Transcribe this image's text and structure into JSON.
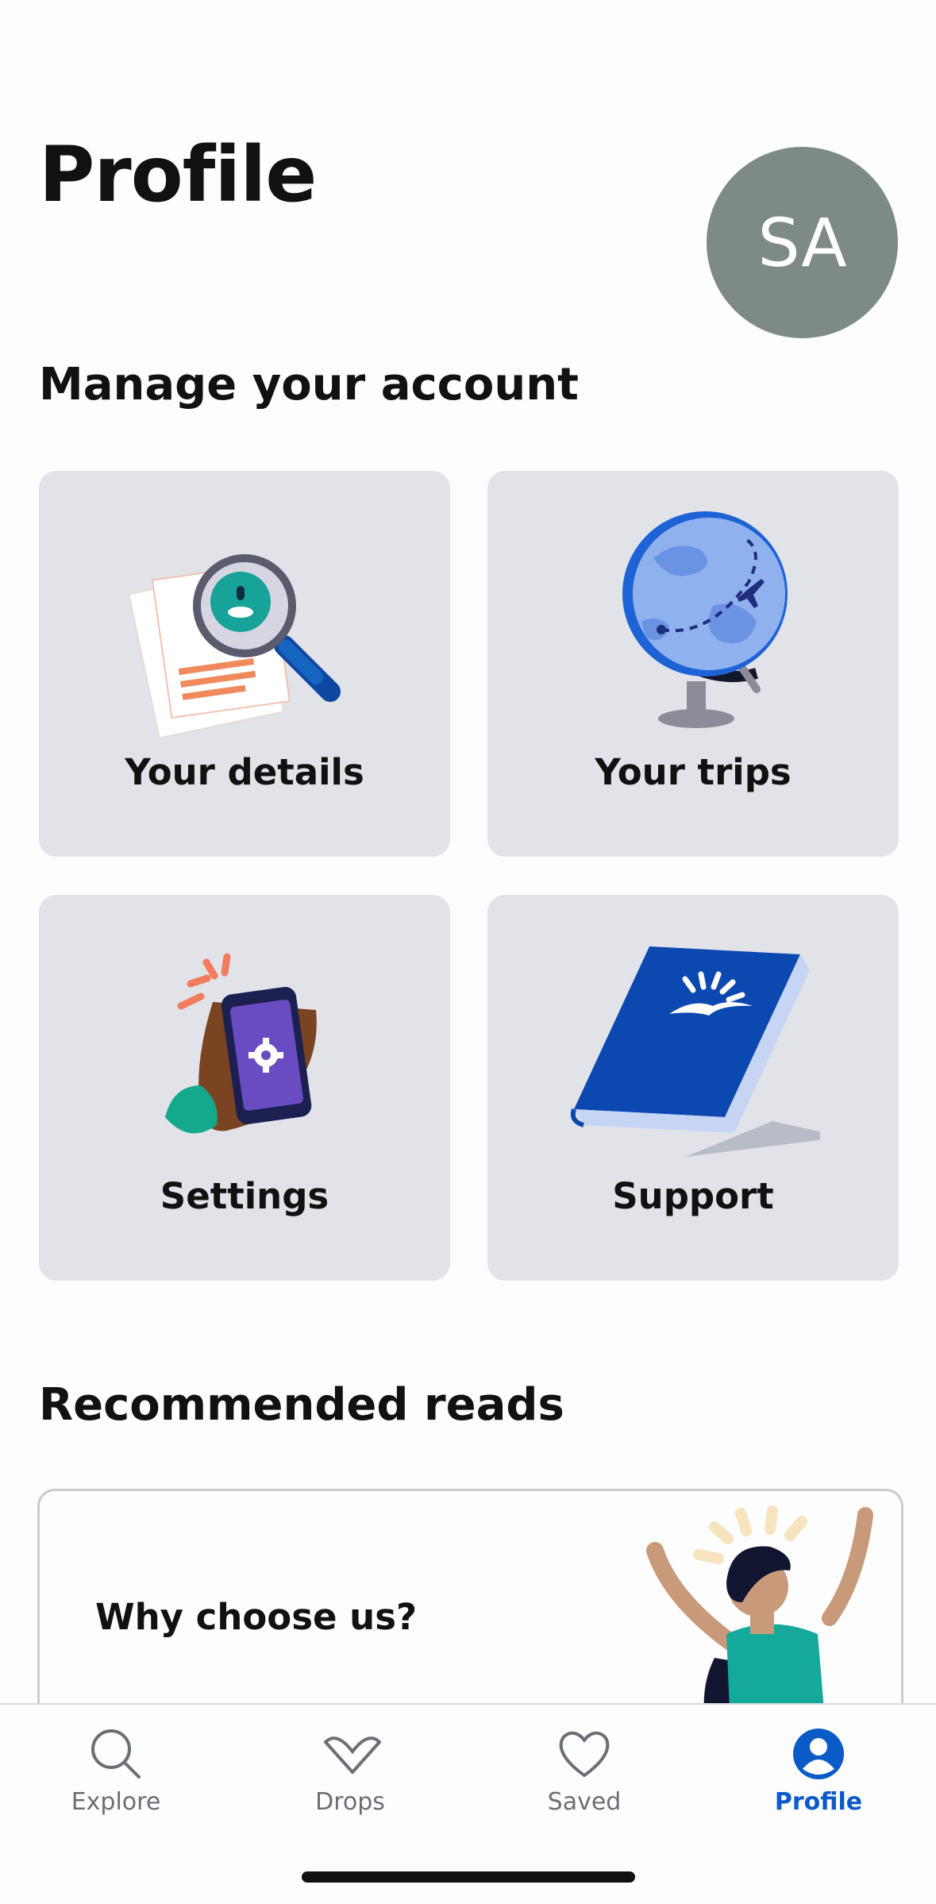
{
  "header": {
    "title": "Profile",
    "avatar_initials": "SA",
    "avatar_color": "#7d8a86"
  },
  "manage": {
    "heading": "Manage your account",
    "tiles": [
      {
        "label": "Your details",
        "icon": "document-magnifier-icon"
      },
      {
        "label": "Your trips",
        "icon": "globe-icon"
      },
      {
        "label": "Settings",
        "icon": "phone-settings-icon"
      },
      {
        "label": "Support",
        "icon": "book-icon"
      }
    ]
  },
  "reads": {
    "heading": "Recommended reads",
    "card_title": "Why choose us?"
  },
  "tabbar": {
    "active_color": "#0a5ac8",
    "tabs": [
      {
        "label": "Explore",
        "icon": "search-icon",
        "active": false
      },
      {
        "label": "Drops",
        "icon": "drops-icon",
        "active": false
      },
      {
        "label": "Saved",
        "icon": "heart-icon",
        "active": false
      },
      {
        "label": "Profile",
        "icon": "profile-icon",
        "active": true
      }
    ]
  }
}
